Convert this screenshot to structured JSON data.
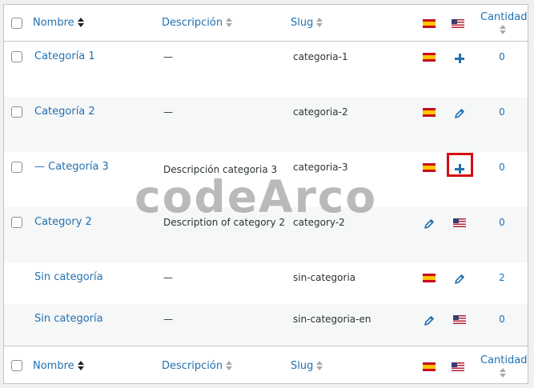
{
  "columns": {
    "name": "Nombre",
    "description": "Descripción",
    "slug": "Slug",
    "count": "Cantidad"
  },
  "rows": [
    {
      "name": "Categoría 1",
      "description": "—",
      "slug": "categoria-1",
      "count": "0",
      "es": "flag",
      "en": "add-icon"
    },
    {
      "name": "Categoría 2",
      "description": "—",
      "slug": "categoria-2",
      "count": "0",
      "es": "flag",
      "en": "edit-icon"
    },
    {
      "name": "— Categoría 3",
      "description": "Descripción categoria 3",
      "slug": "categoria-3",
      "count": "0",
      "es": "flag",
      "en": "add-icon"
    },
    {
      "name": "Category 2",
      "description": "Description of category 2",
      "slug": "category-2",
      "count": "0",
      "es": "edit-icon",
      "en": "flag"
    },
    {
      "name": "Sin categoría",
      "description": "—",
      "slug": "sin-categoria",
      "count": "2",
      "es": "flag",
      "en": "edit-icon"
    },
    {
      "name": "Sin categoría",
      "description": "—",
      "slug": "sin-categoria-en",
      "count": "0",
      "es": "edit-icon",
      "en": "flag"
    }
  ],
  "watermark": "codeArco",
  "colors": {
    "link": "#2271b1",
    "highlight": "#d40d12",
    "border": "#c3c4c7"
  }
}
